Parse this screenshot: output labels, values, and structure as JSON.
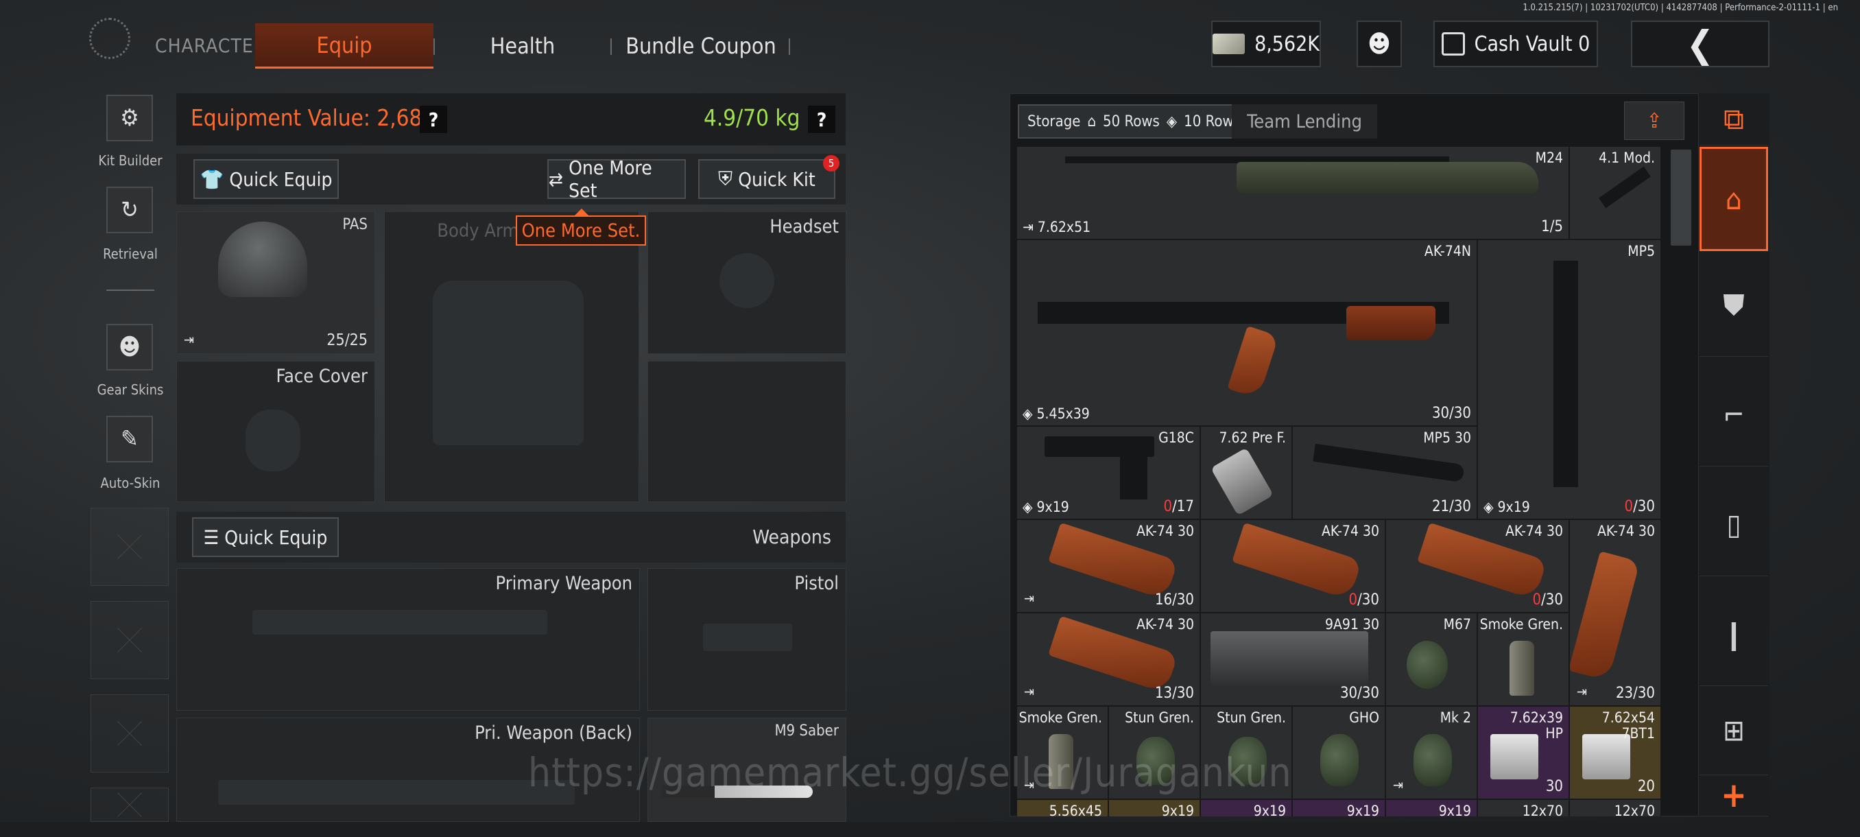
{
  "version_info": "1.0.215.215(7) | 10231702(UTC0) | 4142877408 | Performance-2-01111-1 | en",
  "nav": {
    "brand": "CHARACTER",
    "tabs": [
      {
        "label": "Equip",
        "active": true
      },
      {
        "label": "Health",
        "active": false
      },
      {
        "label": "Bundle Coupon",
        "active": false
      }
    ],
    "cash": "8,562K",
    "cash_vault": "Cash Vault 0",
    "back_glyph": "❮",
    "accent_color": "#ff6a2c"
  },
  "left_rail": [
    {
      "label": "Kit Builder",
      "icon": "kit-builder-icon",
      "glyph": "⚙"
    },
    {
      "label": "Retrieval",
      "icon": "retrieval-icon",
      "glyph": "↻"
    },
    {
      "label": "Gear Skins",
      "icon": "gear-skins-icon",
      "glyph": "☻"
    },
    {
      "label": "Auto-Skin",
      "icon": "auto-skin-icon",
      "glyph": "✎"
    }
  ],
  "equipment": {
    "value_label": "Equipment Value: 2,682",
    "weight": "4.9/70 kg",
    "help_glyph": "?",
    "quick_equip": "Quick Equip",
    "one_more_set": "One More Set",
    "quick_kit": "Quick Kit",
    "quick_kit_badge": "5",
    "tooltip": "One More Set.",
    "slots": {
      "helmet": {
        "label": "PAS",
        "count": "25/25"
      },
      "body_armor": {
        "label": "Body Armor"
      },
      "headset": {
        "label": "Headset"
      },
      "face_cover": {
        "label": "Face Cover"
      }
    },
    "weapons_section": {
      "quick_equip": "Quick Equip",
      "title": "Weapons",
      "primary": "Primary Weapon",
      "pistol": "Pistol",
      "primary_back": "Pri. Weapon (Back)",
      "melee": "M9 Saber"
    }
  },
  "storage": {
    "tab_label": "Storage",
    "rows_a": "50 Rows",
    "rows_b": "10 Rows",
    "team_lending": "Team Lending",
    "items": {
      "m24": {
        "name": "M24",
        "caliber": "7.62x51",
        "count": "1/5"
      },
      "mod": {
        "name": "4.1 Mod."
      },
      "ak74n": {
        "name": "AK-74N",
        "caliber": "5.45x39",
        "count": "30/30"
      },
      "mp5": {
        "name": "MP5",
        "caliber": "9x19",
        "count_red": "0",
        "count_rest": "/30"
      },
      "g18c": {
        "name": "G18C",
        "caliber": "9x19",
        "count_red": "0",
        "count_rest": "/17"
      },
      "pref": {
        "name": "7.62 Pre F."
      },
      "mp5mag": {
        "name": "MP5 30",
        "count": "21/30"
      },
      "ak74_a": {
        "name": "AK-74 30",
        "count": "16/30"
      },
      "ak74_b": {
        "name": "AK-74 30",
        "count_red": "0",
        "count_rest": "/30"
      },
      "ak74_c": {
        "name": "AK-74 30",
        "count_red": "0",
        "count_rest": "/30"
      },
      "ak74_d": {
        "name": "AK-74 30",
        "count": "23/30"
      },
      "ak74_e": {
        "name": "AK-74 30",
        "count": "13/30"
      },
      "9a91": {
        "name": "9A91 30",
        "count": "30/30"
      },
      "m67": {
        "name": "M67"
      },
      "smoke_a": {
        "name": "Smoke Gren."
      },
      "smoke_b": {
        "name": "Smoke Gren."
      },
      "stun_a": {
        "name": "Stun Gren."
      },
      "stun_b": {
        "name": "Stun Gren."
      },
      "gho": {
        "name": "GHO"
      },
      "mk2": {
        "name": "Mk 2"
      },
      "ammo_hp": {
        "name": "7.62x39",
        "sub": "HP",
        "count": "30"
      },
      "ammo_7bt1": {
        "name": "7.62x54",
        "sub": "7BT1",
        "count": "20"
      },
      "row8": [
        "5.56x45",
        "9x19",
        "9x19",
        "9x19",
        "9x19",
        "12x70",
        "12x70"
      ]
    }
  },
  "categories": [
    {
      "icon": "inventory-toggle-icon",
      "glyph": "⧉"
    },
    {
      "icon": "home-icon",
      "glyph": "⌂"
    },
    {
      "icon": "armor-icon",
      "glyph": "⛊"
    },
    {
      "icon": "rifle-icon",
      "glyph": "⌐"
    },
    {
      "icon": "magazine-icon",
      "glyph": "▯"
    },
    {
      "icon": "ammo-icon",
      "glyph": "❙"
    },
    {
      "icon": "attachment-icon",
      "glyph": "⊞"
    },
    {
      "icon": "add-icon",
      "glyph": "+"
    }
  ],
  "watermark": "https://gamemarket.gg/seller/Juragankun"
}
